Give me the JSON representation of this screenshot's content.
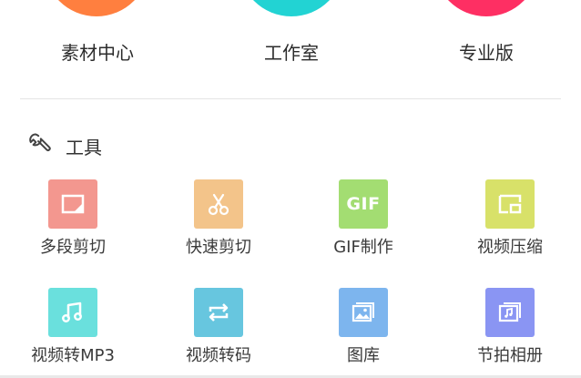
{
  "top_row": [
    {
      "label": "素材中心",
      "color": "#ff7f3f"
    },
    {
      "label": "工作室",
      "color": "#22d3d3"
    },
    {
      "label": "专业版",
      "color": "#fe2f63"
    }
  ],
  "tools_section": {
    "title": "工具",
    "icon": "wrench-icon",
    "items": [
      {
        "label": "多段剪切",
        "icon": "multi-cut-icon",
        "color": "#f3978f"
      },
      {
        "label": "快速剪切",
        "icon": "scissors-icon",
        "color": "#f3c48a"
      },
      {
        "label": "GIF制作",
        "icon": "gif-icon",
        "tile_text": "GIF",
        "color": "#a3dd72"
      },
      {
        "label": "视频压缩",
        "icon": "compress-icon",
        "color": "#d8e169"
      },
      {
        "label": "视频转MP3",
        "icon": "music-note-icon",
        "color": "#6ae0dd"
      },
      {
        "label": "视频转码",
        "icon": "transcode-icon",
        "color": "#67c6df"
      },
      {
        "label": "图库",
        "icon": "gallery-icon",
        "color": "#7db5ee"
      },
      {
        "label": "节拍相册",
        "icon": "beat-album-icon",
        "color": "#8a95f3"
      }
    ]
  }
}
